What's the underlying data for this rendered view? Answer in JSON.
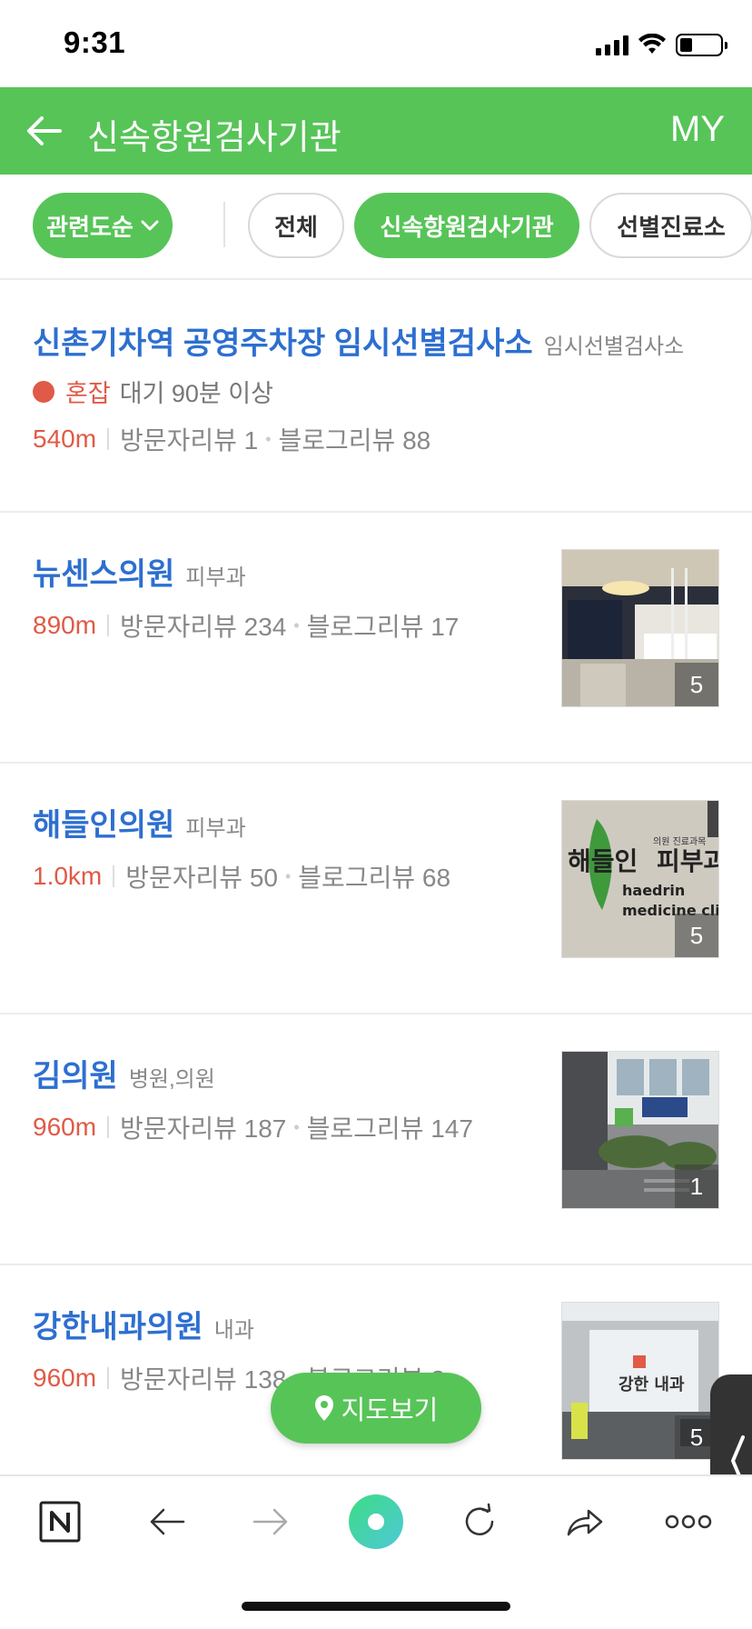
{
  "status_bar": {
    "time": "9:31",
    "battery_level": 0.3
  },
  "header": {
    "title": "신속항원검사기관",
    "my_label": "MY",
    "color": "#57c458"
  },
  "filters": {
    "sort_label": "관련도순",
    "chips": [
      "전체",
      "신속항원검사기관",
      "선별진료소"
    ],
    "active_chip": "신속항원검사기관"
  },
  "listings": [
    {
      "name": "신촌기차역 공영주차장 임시선별검사소",
      "category": "임시선별검사소",
      "status": "혼잡",
      "wait": "대기 90분 이상",
      "distance": "540m",
      "visitor_reviews": "방문자리뷰 1",
      "blog_reviews": "블로그리뷰 88"
    },
    {
      "name": "뉴센스의원",
      "category": "피부과",
      "distance": "890m",
      "visitor_reviews": "방문자리뷰 234",
      "blog_reviews": "블로그리뷰 17",
      "photo_count": "5"
    },
    {
      "name": "해들인의원",
      "category": "피부과",
      "distance": "1.0km",
      "visitor_reviews": "방문자리뷰 50",
      "blog_reviews": "블로그리뷰 68",
      "photo_count": "5",
      "photo_text": {
        "title": "해들인 피부과",
        "header": "의원 진료과목",
        "english": "haedrin",
        "english2": "medicine clinic"
      }
    },
    {
      "name": "김의원",
      "category": "병원,의원",
      "distance": "960m",
      "visitor_reviews": "방문자리뷰 187",
      "blog_reviews": "블로그리뷰 147",
      "photo_count": "1"
    },
    {
      "name": "강한내과의원",
      "category": "내과",
      "distance": "960m",
      "visitor_reviews": "방문자리뷰 138",
      "blog_reviews": "블로그리뷰 2",
      "photo_count": "5",
      "photo_text": {
        "sign": "강한 내과"
      }
    }
  ],
  "map_button": {
    "label": "지도보기"
  },
  "toolbar": {
    "icons": [
      "naver-home-icon",
      "back-icon",
      "forward-icon",
      "green-dot-icon",
      "reload-icon",
      "share-icon",
      "more-icon"
    ]
  }
}
